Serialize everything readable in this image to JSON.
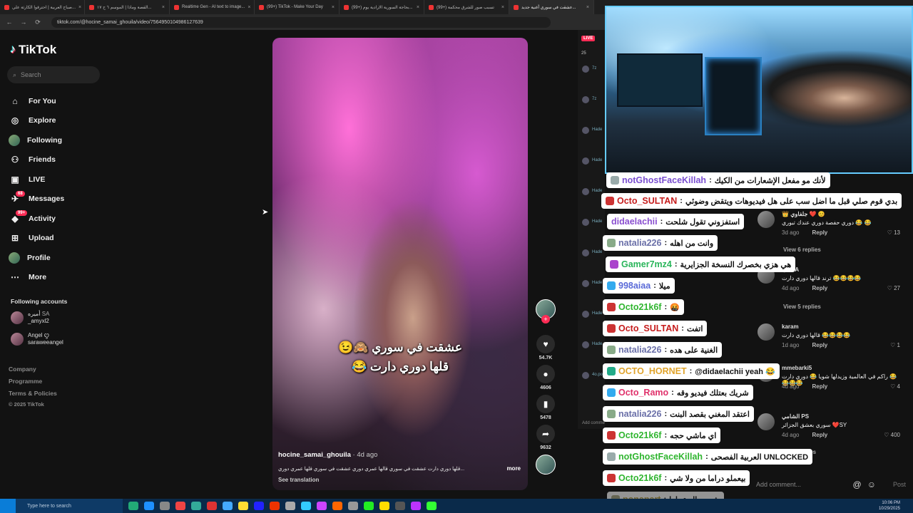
{
  "browser": {
    "tabs": [
      {
        "label": "صباح العربية | احترقوا الكارثة علي..."
      },
      {
        "label": "القصة وماذا | الموسم ٦ ح ١٧..."
      },
      {
        "label": "Realtime Gen - AI text to image..."
      },
      {
        "label": "(99+) TikTok - Make Your Day"
      },
      {
        "label": "(99+) بحاجة السورية الارادية يوم..."
      },
      {
        "label": "(99+) تسبب صور للشرق محكمة"
      },
      {
        "label": "عشقت في سوري أغنية جديد..."
      }
    ],
    "url": "tiktok.com/@hocine_samai_ghouila/video/7564950104986127639"
  },
  "sidebar": {
    "logo": "TikTok",
    "search_placeholder": "Search",
    "menu": [
      {
        "label": "For You",
        "icon": "home-icon"
      },
      {
        "label": "Explore",
        "icon": "compass-icon"
      },
      {
        "label": "Following",
        "icon": "avatar"
      },
      {
        "label": "Friends",
        "icon": "friends-icon"
      },
      {
        "label": "LIVE",
        "icon": "live-icon"
      },
      {
        "label": "Messages",
        "icon": "messages-icon",
        "badge": "68"
      },
      {
        "label": "Activity",
        "icon": "activity-icon",
        "badge": "99+"
      },
      {
        "label": "Upload",
        "icon": "upload-icon"
      },
      {
        "label": "Profile",
        "icon": "avatar"
      },
      {
        "label": "More",
        "icon": "more-icon"
      }
    ],
    "following_title": "Following accounts",
    "following": [
      {
        "name": "أميره",
        "flag": "SA",
        "handle": "_amyxl2"
      },
      {
        "name": "Angel ꨄ",
        "handle": "saraweeangel"
      }
    ],
    "footer": [
      "Company",
      "Programme",
      "Terms & Policies",
      "© 2025 TikTok"
    ]
  },
  "video": {
    "caption_line1": "عشقت في سوري 🙈😉",
    "caption_line2": "قلها دوري دارت 😂",
    "author": "hocine_samai_ghouila",
    "ago": " · 4d ago",
    "description": "...قلها دوري دارت عشقت في سوري قالها عمري دوري عشقت في سوري قلها عمري دوري",
    "more": "more",
    "see_translation": "See translation",
    "likes": "54.7K",
    "comments": "4606",
    "saves": "5478",
    "shares": "9632"
  },
  "live_strip": {
    "live": "LIVE",
    "count": "25",
    "items": [
      "7z",
      "7z",
      "Hade",
      "Hade",
      "Hade",
      "Hade",
      "Hade",
      "Hade",
      "Hade",
      "Hade",
      "4o.po"
    ],
    "add_comment": "Add comme"
  },
  "comments": [
    {
      "name": "👑 جلفاوي ❤️ 😊",
      "text": "دوري حفصة دوري عندك تبوري 😂 😂",
      "ago": "3d ago",
      "reply": "Reply",
      "likes": "13",
      "replies": "View 6 replies"
    },
    {
      "name": "اليا MA",
      "text": "ترند قالها دوري دارت 😂😂😂😂",
      "ago": "4d ago",
      "reply": "Reply",
      "likes": "27",
      "replies": "View 5 replies"
    },
    {
      "name": "karam",
      "text": "قالها دوري دارت 😂😂😂😂",
      "ago": "1d ago",
      "reply": "Reply",
      "likes": "1"
    },
    {
      "name": "mmebarki5",
      "text": "راكم في العالمية وزيدلها شويا 😂 دوري دارت 😂😂😂😂",
      "ago": "4d ago",
      "reply": "Reply",
      "likes": "4"
    },
    {
      "name": "الشامي PS",
      "text": "سوري بعشق الجزائر ❤️SY",
      "ago": "4d ago",
      "reply": "Reply",
      "likes": "400",
      "replies": "View replies"
    }
  ],
  "add_comment": {
    "placeholder": "Add comment...",
    "post": "Post"
  },
  "chat": [
    {
      "user": "notGhostFaceKillah",
      "text": "لأنك مو مفعل الإشعارات من الكيك",
      "color": "#7a4fd0",
      "badge": "#9aa"
    },
    {
      "user": "Octo_SULTAN",
      "text": "بدي قوم صلي قبل ما اضل سب على هل فيديوهات ويتقض وضوئي",
      "color": "#c61c1c",
      "badge": "#c33"
    },
    {
      "user": "didaelachii",
      "text": "استفزوني تقول شلحت",
      "color": "#8a4fd0",
      "badge": ""
    },
    {
      "user": "natalia226",
      "text": "وانت من اهله",
      "color": "#6a6fa8",
      "badge": "#8a8"
    },
    {
      "user": "Gamer7mz4",
      "text": "هي هزي بخصرك النسخة الجزايرية",
      "color": "#29b55a",
      "badge": "#a4c"
    },
    {
      "user": "998aiaa",
      "text": "ميلا",
      "color": "#5a6ad8",
      "badge": "#3ae"
    },
    {
      "user": "Octo21k6f",
      "text": "🤬",
      "color": "#2fb52f",
      "badge": "#c33"
    },
    {
      "user": "Octo_SULTAN",
      "text": "اتفت",
      "color": "#c61c1c",
      "badge": "#c33"
    },
    {
      "user": "natalia226",
      "text": "الغنية على هده",
      "color": "#6a6fa8",
      "badge": "#8a8"
    },
    {
      "user": "OCTO_HORNET",
      "text": "@didaelachii yeah 😂",
      "color": "#e0a32a",
      "badge": "#2a8"
    },
    {
      "user": "Octo_Ramo",
      "text": "شريك بعتلك فيديو وقه",
      "color": "#e0306a",
      "badge": "#3ae"
    },
    {
      "user": "natalia226",
      "text": "اعتقد المغني بقصد البنت",
      "color": "#6a6fa8",
      "badge": "#8a8"
    },
    {
      "user": "Octo21k6f",
      "text": "اي ماشي حجه",
      "color": "#2fb52f",
      "badge": "#c33"
    },
    {
      "user": "notGhostFaceKillah",
      "text": "العربية الفصحى UNLOCKED",
      "color": "#2fb52f",
      "badge": "#9aa"
    },
    {
      "user": "Octo21k6f",
      "text": "بيعملو دراما من ولا شي",
      "color": "#2fb52f",
      "badge": "#c33"
    },
    {
      "user": "ponapart",
      "text": "شو مجال عملها",
      "color": "#b8a040",
      "badge": "#aa8"
    }
  ],
  "taskbar": {
    "search_placeholder": "Type here to search",
    "time": "10:06 PM",
    "date": "10/29/2025"
  }
}
